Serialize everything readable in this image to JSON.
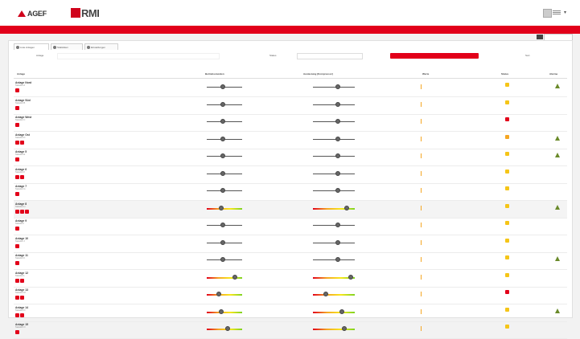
{
  "brand": {
    "logo1_text": "AGEF",
    "logo1_sub": "",
    "logo2_text": "RMI"
  },
  "tabs": [
    {
      "label": "Liste Anlagen"
    },
    {
      "label": "Statistiken"
    },
    {
      "label": "Einstellungen"
    }
  ],
  "filters": {
    "search_label": "Anlage",
    "status_label": "Status",
    "note": "",
    "apply_label": "",
    "sort_label": "Sort"
  },
  "headers": {
    "name": "Anlage",
    "gauge1": "Betriebsstunden",
    "gauge2": "Auslastung (Kompressor)",
    "values": "Werte",
    "state": "Status",
    "alarm": "Alarme"
  },
  "colors": {
    "brand_red": "#e2001a",
    "warn_green": "#6a8a2a",
    "yellow": "#f5c518",
    "orange": "#f5a623"
  },
  "rows": [
    {
      "name": "Anlage Nord",
      "sub": "Standort A",
      "icons": 1,
      "v1": "",
      "v1s": "",
      "v2": "",
      "v2s": "",
      "state": "yellow",
      "state_lbl": "",
      "alarm": true,
      "colored": false,
      "k1": 0.45,
      "k2": 0.6
    },
    {
      "name": "Anlage Süd",
      "sub": "Standort B",
      "icons": 1,
      "v1": "",
      "v1s": "",
      "v2": "",
      "v2s": "",
      "state": "yellow",
      "state_lbl": "",
      "alarm": false,
      "colored": false,
      "k1": 0.45,
      "k2": 0.6
    },
    {
      "name": "Anlage West",
      "sub": "Standort C",
      "icons": 1,
      "v1": "",
      "v1s": "",
      "v2": "",
      "v2s": "",
      "state": "red",
      "state_lbl": "",
      "alarm": false,
      "colored": false,
      "k1": 0.45,
      "k2": 0.6
    },
    {
      "name": "Anlage Ost",
      "sub": "Standort D",
      "icons": 2,
      "v1": "",
      "v1s": "",
      "v2": "",
      "v2s": "",
      "state": "orange",
      "state_lbl": "",
      "alarm": true,
      "colored": false,
      "k1": 0.45,
      "k2": 0.6
    },
    {
      "name": "Anlage 5",
      "sub": "Standort E",
      "icons": 1,
      "v1": "",
      "v1s": "",
      "v2": "",
      "v2s": "",
      "state": "yellow",
      "state_lbl": "",
      "alarm": true,
      "colored": false,
      "k1": 0.45,
      "k2": 0.6
    },
    {
      "name": "Anlage 6",
      "sub": "Standort F",
      "icons": 2,
      "v1": "",
      "v1s": "",
      "v2": "",
      "v2s": "",
      "state": "yellow",
      "state_lbl": "",
      "alarm": false,
      "colored": false,
      "k1": 0.45,
      "k2": 0.6
    },
    {
      "name": "Anlage 7",
      "sub": "Standort G",
      "icons": 1,
      "v1": "",
      "v1s": "",
      "v2": "",
      "v2s": "",
      "state": "yellow",
      "state_lbl": "",
      "alarm": false,
      "colored": false,
      "k1": 0.45,
      "k2": 0.6
    },
    {
      "name": "Anlage 8",
      "sub": "Standort H",
      "icons": 3,
      "v1": "",
      "v1s": "",
      "v2": "",
      "v2s": "",
      "state": "yellow",
      "state_lbl": "",
      "alarm": true,
      "colored": true,
      "k1": 0.4,
      "k2": 0.8,
      "g2num": ""
    },
    {
      "name": "Anlage 9",
      "sub": "Standort I",
      "icons": 1,
      "v1": "",
      "v1s": "",
      "v2": "",
      "v2s": "",
      "state": "yellow",
      "state_lbl": "",
      "alarm": false,
      "colored": false,
      "k1": 0.45,
      "k2": 0.6
    },
    {
      "name": "Anlage 10",
      "sub": "Standort J",
      "icons": 1,
      "v1": "",
      "v1s": "",
      "v2": "",
      "v2s": "",
      "state": "yellow",
      "state_lbl": "",
      "alarm": false,
      "colored": false,
      "k1": 0.45,
      "k2": 0.6
    },
    {
      "name": "Anlage 11",
      "sub": "Standort K",
      "icons": 1,
      "v1": "",
      "v1s": "",
      "v2": "",
      "v2s": "",
      "state": "yellow",
      "state_lbl": "",
      "alarm": true,
      "colored": false,
      "k1": 0.45,
      "k2": 0.6
    },
    {
      "name": "Anlage 12",
      "sub": "Standort L",
      "icons": 2,
      "v1": "",
      "v1s": "",
      "v2": "",
      "v2s": "",
      "state": "yellow",
      "state_lbl": "",
      "alarm": false,
      "colored": true,
      "k1": 0.8,
      "k2": 0.9
    },
    {
      "name": "Anlage 13",
      "sub": "Standort M",
      "icons": 2,
      "v1": "",
      "v1s": "",
      "v2": "",
      "v2s": "",
      "state": "red",
      "state_lbl": "",
      "alarm": false,
      "colored": true,
      "k1": 0.35,
      "k2": 0.3
    },
    {
      "name": "Anlage 14",
      "sub": "Standort N",
      "icons": 2,
      "v1": "",
      "v1s": "",
      "v2": "",
      "v2s": "",
      "state": "yellow",
      "state_lbl": "",
      "alarm": true,
      "colored": true,
      "k1": 0.4,
      "k2": 0.7
    },
    {
      "name": "Anlage 15",
      "sub": "Standort O",
      "icons": 1,
      "v1": "",
      "v1s": "",
      "v2": "",
      "v2s": "",
      "state": "yellow",
      "state_lbl": "",
      "alarm": false,
      "colored": true,
      "k1": 0.6,
      "k2": 0.75,
      "g2num": ""
    }
  ]
}
